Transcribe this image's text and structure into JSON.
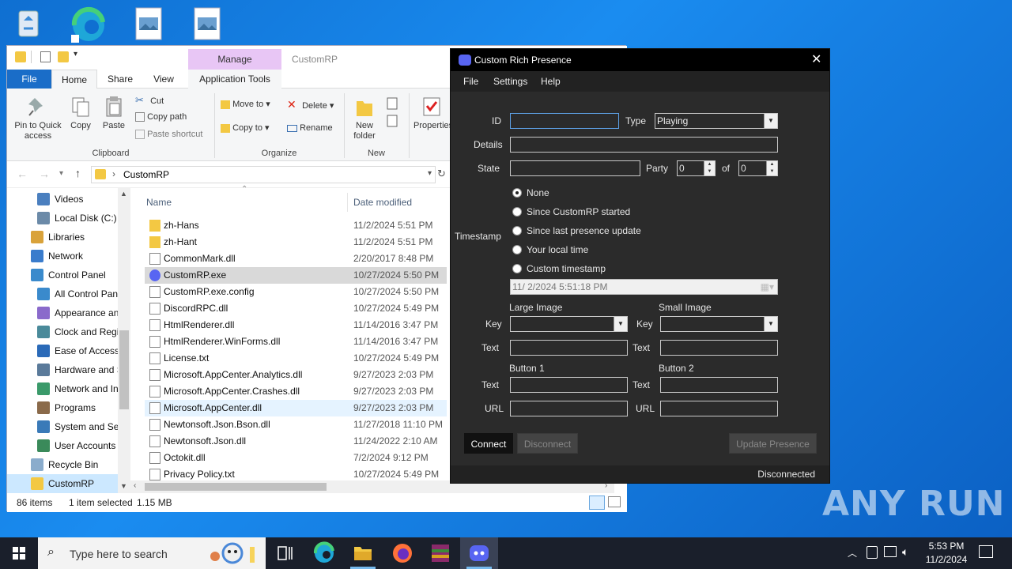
{
  "explorer": {
    "tabs": [
      "File",
      "Home",
      "Share",
      "View"
    ],
    "manage_label": "Manage",
    "app_tools_label": "Application Tools",
    "context_title": "CustomRP",
    "ribbon": {
      "pin_label": "Pin to Quick access",
      "copy_label": "Copy",
      "paste_label": "Paste",
      "cut_label": "Cut",
      "copy_path_label": "Copy path",
      "paste_shortcut_label": "Paste shortcut",
      "clipboard_group": "Clipboard",
      "move_to_label": "Move to",
      "copy_to_label": "Copy to",
      "delete_label": "Delete",
      "rename_label": "Rename",
      "organize_group": "Organize",
      "new_folder_label": "New folder",
      "new_group": "New",
      "properties_label": "Properties"
    },
    "address": "CustomRP",
    "nav_items": [
      "Videos",
      "Local Disk (C:)",
      "Libraries",
      "Network",
      "Control Panel",
      "All Control Panel Items",
      "Appearance and Personalization",
      "Clock and Region",
      "Ease of Access",
      "Hardware and Sound",
      "Network and Internet",
      "Programs",
      "System and Security",
      "User Accounts",
      "Recycle Bin",
      "CustomRP"
    ],
    "columns": {
      "name": "Name",
      "date": "Date modified"
    },
    "files": [
      {
        "name": "zh-Hans",
        "date": "11/2/2024 5:51 PM",
        "kind": "folder"
      },
      {
        "name": "zh-Hant",
        "date": "11/2/2024 5:51 PM",
        "kind": "folder"
      },
      {
        "name": "CommonMark.dll",
        "date": "2/20/2017 8:48 PM",
        "kind": "dll"
      },
      {
        "name": "CustomRP.exe",
        "date": "10/27/2024 5:50 PM",
        "kind": "exe"
      },
      {
        "name": "CustomRP.exe.config",
        "date": "10/27/2024 5:50 PM",
        "kind": "file"
      },
      {
        "name": "DiscordRPC.dll",
        "date": "10/27/2024 5:49 PM",
        "kind": "dll"
      },
      {
        "name": "HtmlRenderer.dll",
        "date": "11/14/2016 3:47 PM",
        "kind": "dll"
      },
      {
        "name": "HtmlRenderer.WinForms.dll",
        "date": "11/14/2016 3:47 PM",
        "kind": "dll"
      },
      {
        "name": "License.txt",
        "date": "10/27/2024 5:49 PM",
        "kind": "txt"
      },
      {
        "name": "Microsoft.AppCenter.Analytics.dll",
        "date": "9/27/2023 2:03 PM",
        "kind": "dll"
      },
      {
        "name": "Microsoft.AppCenter.Crashes.dll",
        "date": "9/27/2023 2:03 PM",
        "kind": "dll"
      },
      {
        "name": "Microsoft.AppCenter.dll",
        "date": "9/27/2023 2:03 PM",
        "kind": "dll"
      },
      {
        "name": "Newtonsoft.Json.Bson.dll",
        "date": "11/27/2018 11:10 PM",
        "kind": "dll"
      },
      {
        "name": "Newtonsoft.Json.dll",
        "date": "11/24/2022 2:10 AM",
        "kind": "dll"
      },
      {
        "name": "Octokit.dll",
        "date": "7/2/2024 9:12 PM",
        "kind": "dll"
      },
      {
        "name": "Privacy Policy.txt",
        "date": "10/27/2024 5:49 PM",
        "kind": "txt"
      }
    ],
    "status": {
      "count": "86 items",
      "selected": "1 item selected",
      "size": "1.15 MB"
    }
  },
  "crp": {
    "title": "Custom Rich Presence",
    "menu": [
      "File",
      "Settings",
      "Help"
    ],
    "id_label": "ID",
    "id_value": "",
    "type_label": "Type",
    "type_value": "Playing",
    "details_label": "Details",
    "details_value": "",
    "state_label": "State",
    "state_value": "",
    "party_label": "Party",
    "party_value": "0",
    "of_label": "of",
    "of_value": "0",
    "timestamp_label": "Timestamp",
    "timestamp_options": [
      "None",
      "Since CustomRP started",
      "Since last presence update",
      "Your local time",
      "Custom timestamp"
    ],
    "timestamp_selected": 0,
    "custom_timestamp": "11/  2/2024    5:51:18 PM",
    "large_image_label": "Large Image",
    "small_image_label": "Small Image",
    "key_label": "Key",
    "text_label": "Text",
    "button1_label": "Button 1",
    "button2_label": "Button 2",
    "url_label": "URL",
    "connect_label": "Connect",
    "disconnect_label": "Disconnect",
    "update_label": "Update Presence",
    "status_text": "Disconnected",
    "accent": "#5865f2"
  },
  "taskbar": {
    "search_placeholder": "Type here to search",
    "time": "5:53 PM",
    "date": "11/2/2024"
  },
  "watermark": "ANY RUN"
}
